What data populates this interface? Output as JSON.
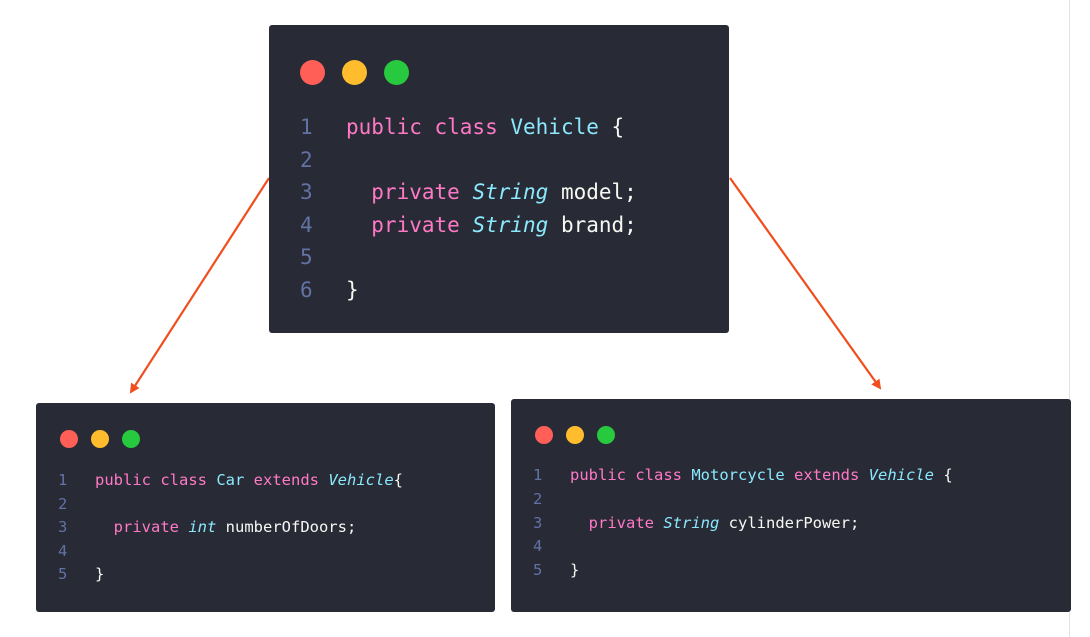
{
  "windows": {
    "vehicle": {
      "lines": [
        {
          "num": "1",
          "parts": [
            {
              "t": "kw",
              "v": "public class "
            },
            {
              "t": "cls",
              "v": "Vehicle"
            },
            {
              "t": "id",
              "v": " {"
            }
          ]
        },
        {
          "num": "2",
          "parts": []
        },
        {
          "num": "3",
          "parts": [
            {
              "t": "kw",
              "v": "  private "
            },
            {
              "t": "typ",
              "v": "String"
            },
            {
              "t": "id",
              "v": " model;"
            }
          ]
        },
        {
          "num": "4",
          "parts": [
            {
              "t": "kw",
              "v": "  private "
            },
            {
              "t": "typ",
              "v": "String"
            },
            {
              "t": "id",
              "v": " brand;"
            }
          ]
        },
        {
          "num": "5",
          "parts": []
        },
        {
          "num": "6",
          "parts": [
            {
              "t": "id",
              "v": "}"
            }
          ]
        }
      ]
    },
    "car": {
      "lines": [
        {
          "num": "1",
          "parts": [
            {
              "t": "kw",
              "v": "public class "
            },
            {
              "t": "cls",
              "v": "Car"
            },
            {
              "t": "kw",
              "v": " extends "
            },
            {
              "t": "typ",
              "v": "Vehicle"
            },
            {
              "t": "id",
              "v": "{"
            }
          ]
        },
        {
          "num": "2",
          "parts": []
        },
        {
          "num": "3",
          "parts": [
            {
              "t": "kw",
              "v": "  private "
            },
            {
              "t": "typ",
              "v": "int"
            },
            {
              "t": "id",
              "v": " numberOfDoors;"
            }
          ]
        },
        {
          "num": "4",
          "parts": []
        },
        {
          "num": "5",
          "parts": [
            {
              "t": "id",
              "v": "}"
            }
          ]
        }
      ]
    },
    "motorcycle": {
      "lines": [
        {
          "num": "1",
          "parts": [
            {
              "t": "kw",
              "v": "public class "
            },
            {
              "t": "cls",
              "v": "Motorcycle"
            },
            {
              "t": "kw",
              "v": " extends "
            },
            {
              "t": "typ",
              "v": "Vehicle"
            },
            {
              "t": "id",
              "v": " {"
            }
          ]
        },
        {
          "num": "2",
          "parts": []
        },
        {
          "num": "3",
          "parts": [
            {
              "t": "kw",
              "v": "  private "
            },
            {
              "t": "typ",
              "v": "String"
            },
            {
              "t": "id",
              "v": " cylinderPower;"
            }
          ]
        },
        {
          "num": "4",
          "parts": []
        },
        {
          "num": "5",
          "parts": [
            {
              "t": "id",
              "v": "}"
            }
          ]
        }
      ]
    }
  },
  "colors": {
    "window_bg": "#282a36",
    "keyword": "#ff79c6",
    "class_name": "#8be9fd",
    "line_number": "#6272a4",
    "text": "#f8f8f2",
    "arrow": "#f04e1f",
    "dot_red": "#ff5f56",
    "dot_yellow": "#ffbd2e",
    "dot_green": "#27c93f"
  },
  "arrows": [
    {
      "from": "vehicle",
      "to": "car"
    },
    {
      "from": "vehicle",
      "to": "motorcycle"
    }
  ]
}
